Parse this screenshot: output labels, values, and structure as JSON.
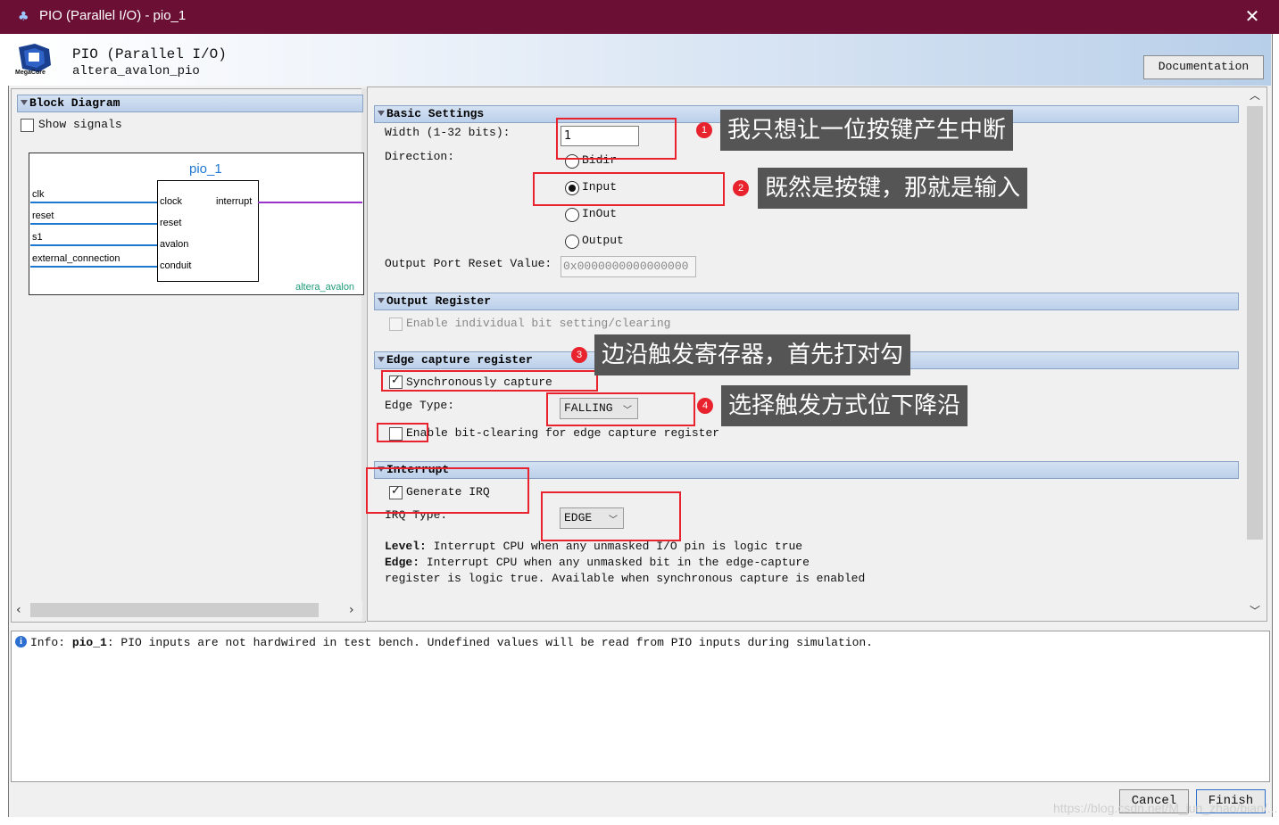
{
  "window": {
    "title": "PIO (Parallel I/O) - pio_1",
    "close_glyph": "✕"
  },
  "header": {
    "title": "PIO (Parallel I/O)",
    "subtitle": "altera_avalon_pio",
    "logo_text": "MegaCore",
    "documentation_label": "Documentation"
  },
  "block_diagram": {
    "section_title": "Block Diagram",
    "show_signals_label": "Show signals",
    "component_name": "pio_1",
    "left_ports": [
      "clk",
      "reset",
      "s1",
      "external_connection"
    ],
    "inner_left": [
      "clock",
      "reset",
      "avalon",
      "conduit"
    ],
    "inner_right": "interrupt",
    "bottom_label": "altera_avalon"
  },
  "basic_settings": {
    "section_title": "Basic Settings",
    "width_label": "Width (1-32 bits):",
    "width_value": "1",
    "direction_label": "Direction:",
    "directions": [
      "Bidir",
      "Input",
      "InOut",
      "Output"
    ],
    "selected_direction": "Input",
    "reset_label": "Output Port Reset Value:",
    "reset_value": "0x0000000000000000"
  },
  "output_register": {
    "section_title": "Output Register",
    "enable_label": "Enable individual bit setting/clearing"
  },
  "edge_capture": {
    "section_title": "Edge capture register",
    "sync_label": "Synchronously capture",
    "edge_type_label": "Edge Type:",
    "edge_type_value": "FALLING",
    "bit_clear_label": "Enable bit-clearing for edge capture register"
  },
  "interrupt": {
    "section_title": "Interrupt",
    "generate_irq_label": "Generate IRQ",
    "irq_type_label": "IRQ Type:",
    "irq_type_value": "EDGE",
    "level_key": "Level:",
    "level_text": "Interrupt CPU when any unmasked I/O pin is logic true",
    "edge_key": "Edge:",
    "edge_text_1": "Interrupt CPU when any unmasked bit in the edge-capture",
    "edge_text_2": "register is logic true. Available when synchronous capture is enabled"
  },
  "annotations": [
    {
      "num": "1",
      "text": "我只想让一位按键产生中断"
    },
    {
      "num": "2",
      "text": "既然是按键，那就是输入"
    },
    {
      "num": "3",
      "text": "边沿触发寄存器，首先打对勾"
    },
    {
      "num": "4",
      "text": "选择触发方式位下降沿"
    }
  ],
  "info": {
    "prefix": "Info: ",
    "component": "pio_1",
    "message": ": PIO inputs are not hardwired in test bench. Undefined values will be read from PIO inputs during simulation."
  },
  "buttons": {
    "cancel": "Cancel",
    "finish": "Finish"
  },
  "watermark": "https://blog.csdn.net/M_jun_zhao/bian/..."
}
